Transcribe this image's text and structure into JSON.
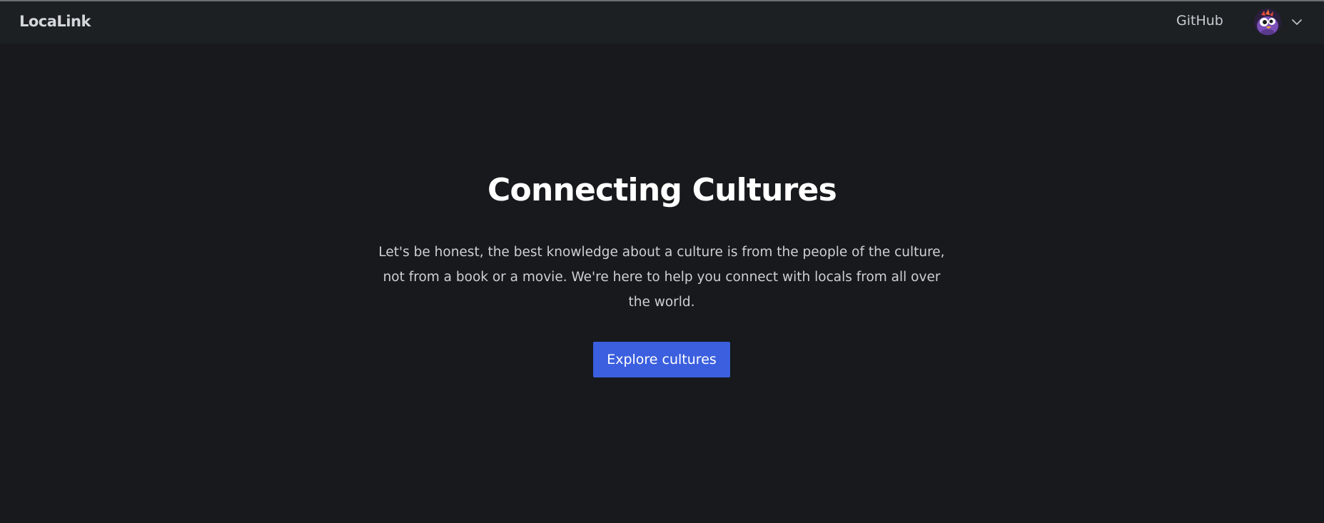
{
  "navbar": {
    "brand": "LocaLink",
    "links": [
      {
        "label": "GitHub"
      }
    ],
    "user_menu": {
      "avatar_icon": "cartoon-bird-avatar",
      "dropdown_icon": "chevron-down-icon"
    }
  },
  "hero": {
    "title": "Connecting Cultures",
    "description": "Let's be honest, the best knowledge about a culture is from the people of the culture, not from a book or a movie. We're here to help you connect with locals from all over the world.",
    "cta_label": "Explore cultures"
  },
  "colors": {
    "background": "#17191c",
    "navbar": "#1d2023",
    "primary_button": "#3b5fde",
    "title_text": "#ffffff",
    "body_text": "#cdd1d6"
  }
}
